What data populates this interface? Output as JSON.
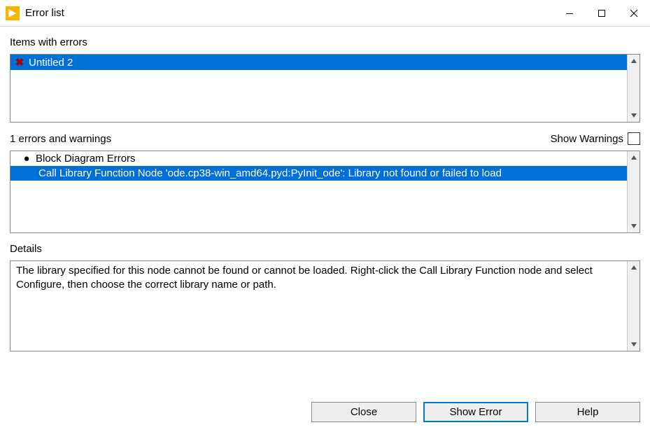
{
  "titlebar": {
    "title": "Error list"
  },
  "sections": {
    "items_label": "Items with errors",
    "errors_label": "1 errors and warnings",
    "show_warnings_label": "Show Warnings",
    "details_label": "Details"
  },
  "items_list": [
    {
      "icon": "x",
      "label": "Untitled 2",
      "selected": true
    }
  ],
  "errors_list": [
    {
      "icon": "bullet",
      "label": "Block Diagram Errors",
      "selected": false,
      "indent": 0
    },
    {
      "icon": "",
      "label": "Call Library Function Node 'ode.cp38-win_amd64.pyd:PyInit_ode': Library not found or failed to load",
      "selected": true,
      "indent": 1
    }
  ],
  "details_text": "The library specified for this node cannot be found or cannot be loaded. Right-click the Call Library Function node and select Configure, then choose the correct library name or path.",
  "buttons": {
    "close": "Close",
    "show_error": "Show Error",
    "help": "Help"
  }
}
